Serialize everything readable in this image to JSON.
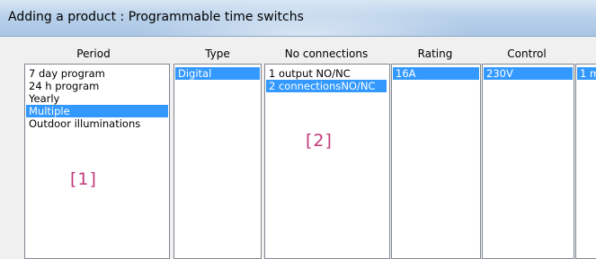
{
  "window": {
    "title": "Adding a product : Programmable time switchs"
  },
  "columns": [
    {
      "header": "Period",
      "items": [
        "7 day program",
        "24 h program",
        "Yearly",
        "Multiple",
        "Outdoor illuminations"
      ],
      "selected": 3
    },
    {
      "header": "Type",
      "items": [
        "Digital"
      ],
      "selected": 0
    },
    {
      "header": "No connections",
      "items": [
        "1 output NO/NC",
        "2 connectionsNO/NC"
      ],
      "selected": 1
    },
    {
      "header": "Rating",
      "items": [
        "16A"
      ],
      "selected": 0
    },
    {
      "header": "Control",
      "items": [
        "230V"
      ],
      "selected": 0
    },
    {
      "header": "",
      "items": [
        "1 m"
      ],
      "selected": 0
    }
  ],
  "annotations": {
    "label1": "[1]",
    "label2": "[2]"
  },
  "colors": {
    "selection": "#3399ff",
    "annotation": "#c0397a"
  }
}
